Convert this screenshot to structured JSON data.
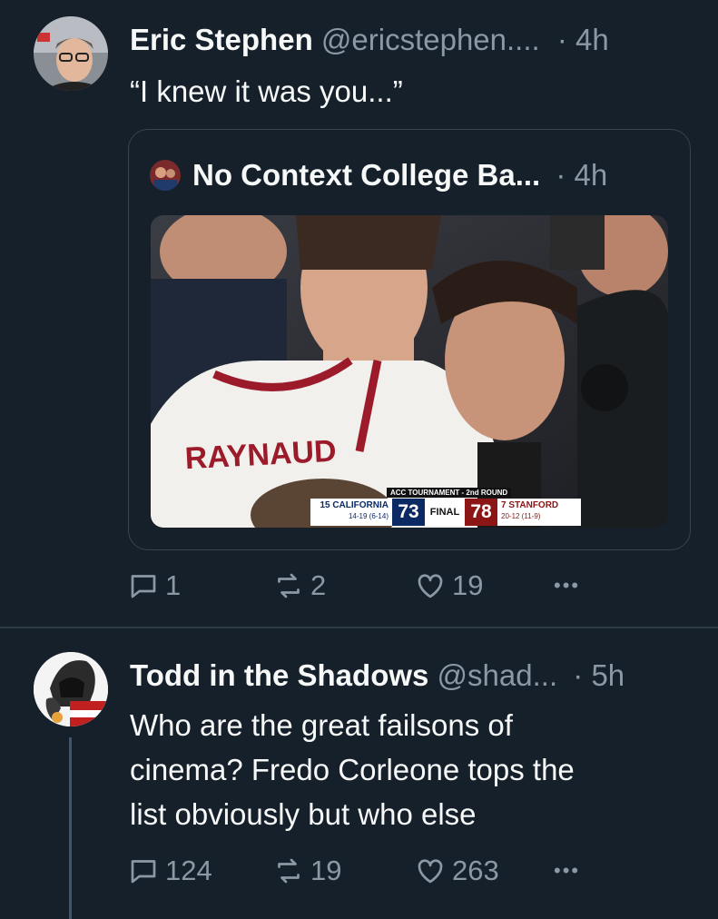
{
  "tweet1": {
    "display_name": "Eric Stephen",
    "handle": "@ericstephen....",
    "time": "· 4h",
    "text": "“I knew it was you...”",
    "quote": {
      "display_name": "No Context College Ba...",
      "time": "· 4h",
      "media": {
        "jersey_name": "RAYNAUD",
        "scorebug": {
          "event": "ACC TOURNAMENT - 2nd ROUND",
          "away_seed_team": "15 CALIFORNIA",
          "away_record": "14-19 (6-14)",
          "away_score": "73",
          "status": "FINAL",
          "home_score": "78",
          "home_seed_team": "7 STANFORD",
          "home_record": "20-12 (11-9)"
        }
      }
    },
    "actions": {
      "replies": "1",
      "retweets": "2",
      "likes": "19",
      "more": "•••"
    }
  },
  "tweet2": {
    "display_name": "Todd in the Shadows",
    "handle": "@shad...",
    "time": "· 5h",
    "text_lines": [
      "Who are the great failsons of",
      "cinema? Fredo Corleone tops the",
      "list obviously but who else"
    ],
    "actions": {
      "replies": "124",
      "retweets": "19",
      "likes": "263",
      "more": "•••"
    }
  },
  "colors": {
    "background": "#15202b",
    "text": "#f7f9f9",
    "muted": "#8b98a5",
    "border": "#38444d"
  },
  "icons": [
    "reply-icon",
    "retweet-icon",
    "like-icon",
    "more-icon"
  ]
}
